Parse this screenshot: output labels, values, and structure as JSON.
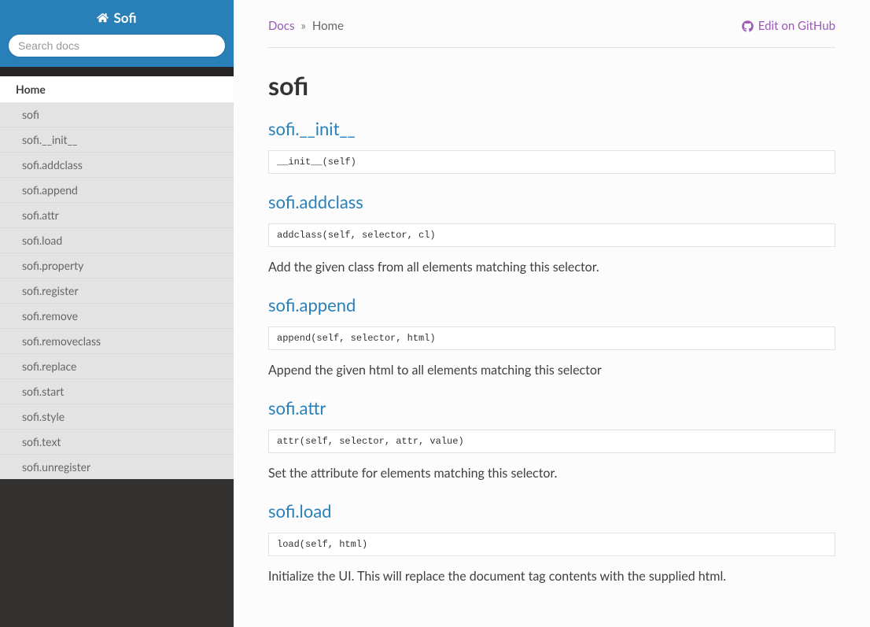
{
  "site": {
    "title": "Sofi"
  },
  "search": {
    "placeholder": "Search docs"
  },
  "sidebar": {
    "current": "Home",
    "items": [
      "sofi",
      "sofi.__init__",
      "sofi.addclass",
      "sofi.append",
      "sofi.attr",
      "sofi.load",
      "sofi.property",
      "sofi.register",
      "sofi.remove",
      "sofi.removeclass",
      "sofi.replace",
      "sofi.start",
      "sofi.style",
      "sofi.text",
      "sofi.unregister"
    ]
  },
  "breadcrumb": {
    "root": "Docs",
    "sep": "»",
    "current": "Home",
    "edit": "Edit on GitHub"
  },
  "page": {
    "title": "sofi",
    "sections": [
      {
        "heading": "sofi.__init__",
        "code": "__init__(self)",
        "desc": ""
      },
      {
        "heading": "sofi.addclass",
        "code": "addclass(self, selector, cl)",
        "desc": "Add the given class from all elements matching this selector."
      },
      {
        "heading": "sofi.append",
        "code": "append(self, selector, html)",
        "desc": "Append the given html to all elements matching this selector"
      },
      {
        "heading": "sofi.attr",
        "code": "attr(self, selector, attr, value)",
        "desc": "Set the attribute for elements matching this selector."
      },
      {
        "heading": "sofi.load",
        "code": "load(self, html)",
        "desc": "Initialize the UI. This will replace the document tag contents with the supplied html."
      }
    ]
  }
}
